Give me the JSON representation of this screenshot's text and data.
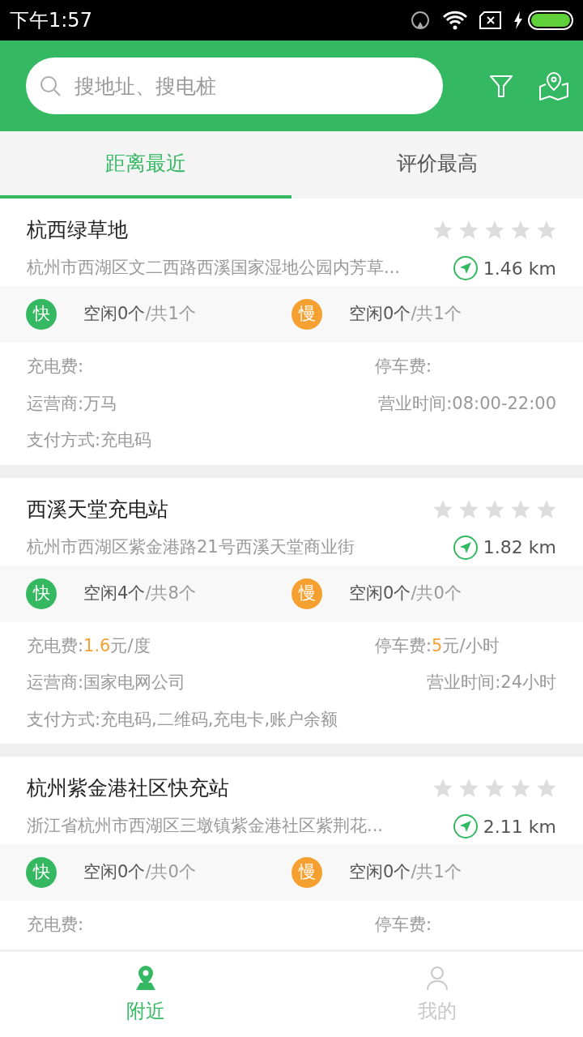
{
  "status_bar": {
    "time": "下午1:57"
  },
  "search": {
    "placeholder": "搜地址、搜电桩"
  },
  "tabs": [
    {
      "label": "距离最近",
      "selected": true
    },
    {
      "label": "评价最高",
      "selected": false
    }
  ],
  "stations": [
    {
      "name": "杭西绿草地",
      "stars": 0,
      "address": "杭州市西湖区文二西路西溪国家湿地公园内芳草...",
      "distance": "1.46 km",
      "fast": {
        "badge": "快",
        "idle": "空闲0个",
        "total": "/共1个"
      },
      "slow": {
        "badge": "慢",
        "idle": "空闲0个",
        "total": "/共1个"
      },
      "charge_fee": {
        "label": "充电费:"
      },
      "parking_fee": {
        "label": "停车费:"
      },
      "operator": "运营商:万马",
      "hours": "营业时间:08:00-22:00",
      "payment": "支付方式:充电码"
    },
    {
      "name": "西溪天堂充电站",
      "stars": 0,
      "address": "杭州市西湖区紫金港路21号西溪天堂商业街",
      "distance": "1.82 km",
      "fast": {
        "badge": "快",
        "idle": "空闲4个",
        "total": "/共8个"
      },
      "slow": {
        "badge": "慢",
        "idle": "空闲0个",
        "total": "/共0个"
      },
      "charge_fee": {
        "label": "充电费:",
        "value": "1.6",
        "unit": "元/度"
      },
      "parking_fee": {
        "label": "停车费:",
        "value": "5",
        "unit": "元/小时"
      },
      "operator": "运营商:国家电网公司",
      "hours": "营业时间:24小时",
      "payment": "支付方式:充电码,二维码,充电卡,账户余额"
    },
    {
      "name": "杭州紫金港社区快充站",
      "stars": 0,
      "address": "浙江省杭州市西湖区三墩镇紫金港社区紫荆花...",
      "distance": "2.11 km",
      "fast": {
        "badge": "快",
        "idle": "空闲0个",
        "total": "/共0个"
      },
      "slow": {
        "badge": "慢",
        "idle": "空闲0个",
        "total": "/共1个"
      },
      "charge_fee": {
        "label": "充电费:"
      },
      "parking_fee": {
        "label": "停车费:"
      }
    }
  ],
  "bottom_nav": [
    {
      "kind": "pin",
      "label": "附近",
      "selected": true
    },
    {
      "kind": "person",
      "label": "我的",
      "selected": false
    }
  ]
}
